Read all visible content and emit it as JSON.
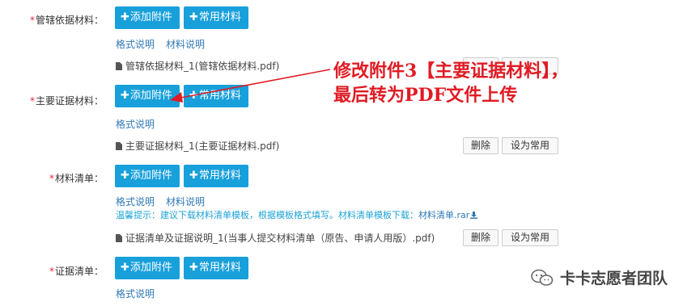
{
  "sections": [
    {
      "label": "管辖依据材料",
      "add_button": "添加附件",
      "common_button": "常用材料",
      "links": [
        "格式说明",
        "材料说明"
      ],
      "file": "管辖依据材料_1(管辖依据材料.pdf)"
    },
    {
      "label": "主要证据材料",
      "add_button": "添加附件",
      "common_button": "常用材料",
      "links": [
        "格式说明"
      ],
      "file": "主要证据材料_1(主要证据材料.pdf)",
      "delete_button": "删除",
      "set_common_button": "设为常用"
    },
    {
      "label": "材料清单",
      "add_button": "添加附件",
      "common_button": "常用材料",
      "links": [
        "格式说明",
        "材料说明"
      ],
      "hint": "温馨提示：建议下载材料清单模板，根据模板格式填写。材料清单模板下载：",
      "hint_link": "材料清单.rar",
      "file": "证据清单及证据说明_1(当事人提交材料清单（原告、申请人用版）.pdf)",
      "delete_button": "删除",
      "set_common_button": "设为常用"
    },
    {
      "label": "证据清单",
      "add_button": "添加附件",
      "common_button": "常用材料",
      "links": [
        "格式说明"
      ]
    }
  ],
  "required_mark": "*",
  "label_suffix": "：",
  "annotation": {
    "line1": "修改附件3【主要证据材料】，",
    "line2": "最后转为PDF文件上传",
    "color": "#e01b24"
  },
  "watermark": "卡卡志愿者团队",
  "colors": {
    "primary": "#18a0db",
    "link": "#2f78b5",
    "hint": "#1ea3d8",
    "required": "#e22233"
  }
}
